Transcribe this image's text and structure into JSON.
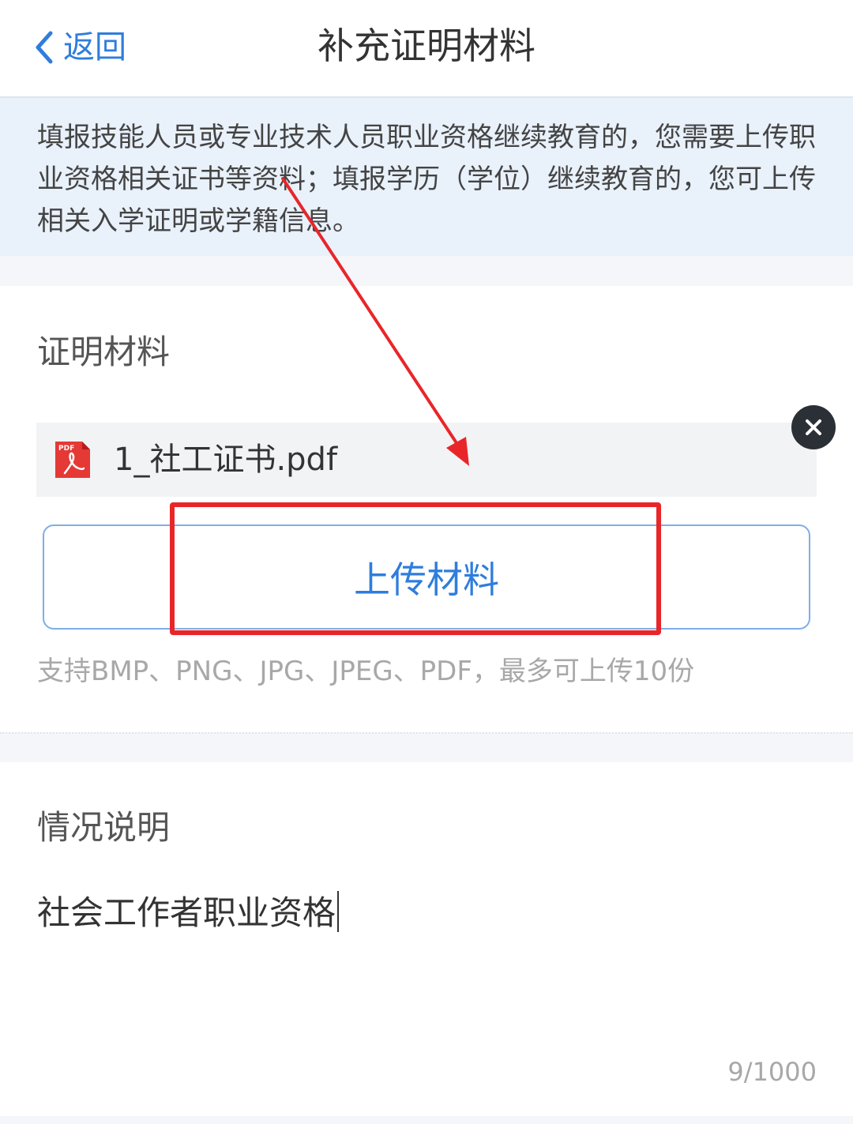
{
  "header": {
    "back_label": "返回",
    "title": "补充证明材料"
  },
  "notice": {
    "text": "填报技能人员或专业技术人员职业资格继续教育的，您需要上传职业资格相关证书等资料；填报学历（学位）继续教育的，您可上传相关入学证明或学籍信息。"
  },
  "materials": {
    "section_title": "证明材料",
    "file": {
      "name": "1_社工证书.pdf",
      "icon_label": "PDF"
    },
    "upload_label": "上传材料",
    "support_text": "支持BMP、PNG、JPG、JPEG、PDF，最多可上传10份"
  },
  "description": {
    "section_title": "情况说明",
    "value": "社会工作者职业资格",
    "counter": "9/1000"
  },
  "colors": {
    "accent": "#2f7ddc",
    "annotation": "#e8262a",
    "notice_bg": "#e9f1fb"
  }
}
